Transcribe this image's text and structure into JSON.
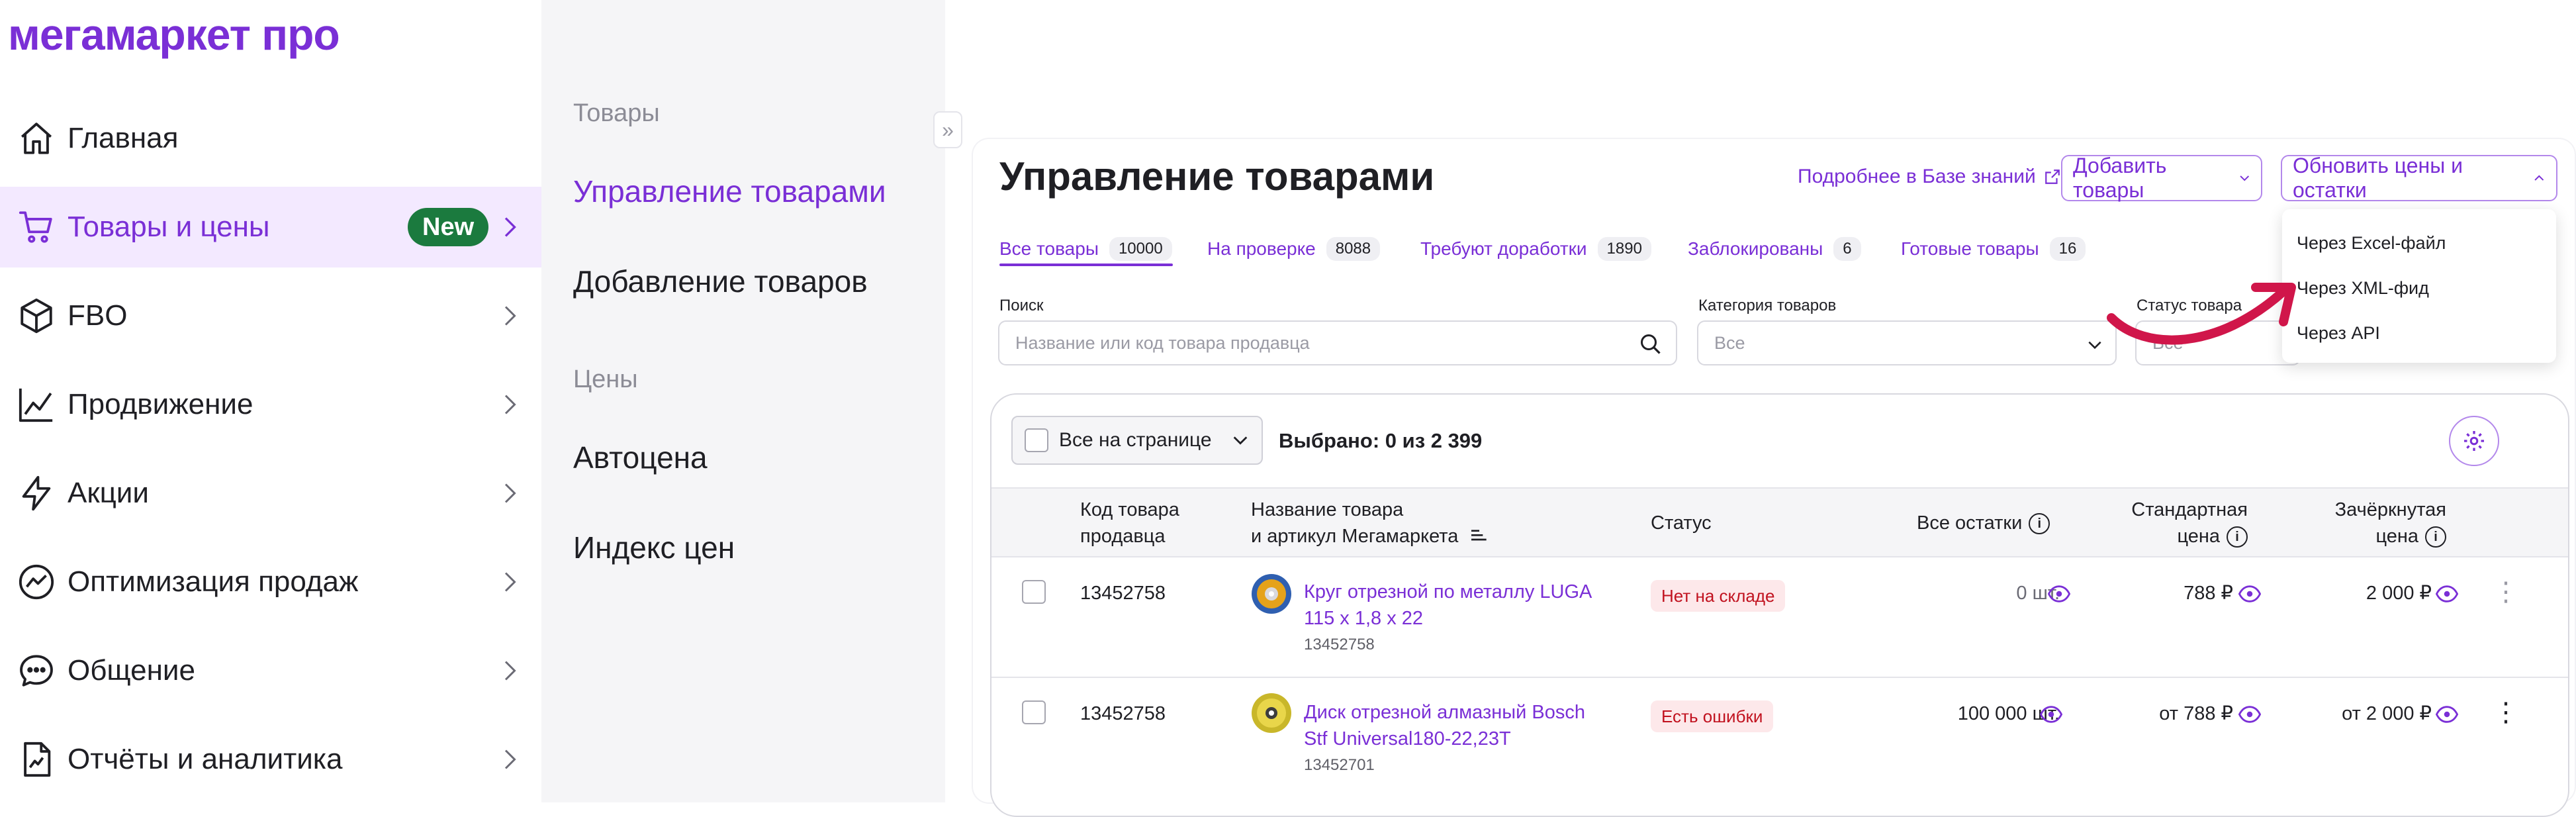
{
  "sidebar": {
    "logo": "мегамаркет про",
    "items": [
      {
        "label": "Главная",
        "icon": "home-icon"
      },
      {
        "label": "Товары и цены",
        "icon": "cart-icon",
        "badge": "New",
        "active": true
      },
      {
        "label": "FBO",
        "icon": "box-icon"
      },
      {
        "label": "Продвижение",
        "icon": "chart-line-icon"
      },
      {
        "label": "Акции",
        "icon": "lightning-icon"
      },
      {
        "label": "Оптимизация продаж",
        "icon": "trend-icon"
      },
      {
        "label": "Общение",
        "icon": "chat-icon"
      },
      {
        "label": "Отчёты и аналитика",
        "icon": "report-icon"
      }
    ]
  },
  "submenu": {
    "section_goods": "Товары",
    "item_manage": "Управление товарами",
    "item_add": "Добавление товаров",
    "section_prices": "Цены",
    "item_autoprice": "Автоцена",
    "item_price_index": "Индекс цен"
  },
  "header": {
    "title": "Управление товарами",
    "kb_link": "Подробнее в Базе знаний",
    "add_goods": "Добавить товары",
    "update_prices": "Обновить цены и остатки"
  },
  "tabs": [
    {
      "label": "Все товары",
      "count": "10000",
      "active": true
    },
    {
      "label": "На проверке",
      "count": "8088"
    },
    {
      "label": "Требуют доработки",
      "count": "1890"
    },
    {
      "label": "Заблокированы",
      "count": "6"
    },
    {
      "label": "Готовые товары",
      "count": "16"
    }
  ],
  "filters": {
    "search_label": "Поиск",
    "search_placeholder": "Название или код товара продавца",
    "category_label": "Категория товаров",
    "category_value": "Все",
    "status_label": "Статус товара",
    "status_value": "Все"
  },
  "dropdown": {
    "items": [
      "Через Excel-файл",
      "Через XML-фид",
      "Через API"
    ]
  },
  "table": {
    "select_all": "Все на странице",
    "selected": "Выбрано: 0 из 2 399",
    "headers": {
      "code_1": "Код товара",
      "code_2": "продавца",
      "name_1": "Название товара",
      "name_2": "и артикул Мегамаркета",
      "status": "Статус",
      "stock": "Все остатки",
      "std_1": "Стандартная",
      "std_2": "цена",
      "crossed_1": "Зачёркнутая",
      "crossed_2": "цена"
    },
    "rows": [
      {
        "code": "13452758",
        "name_1": "Круг отрезной по металлу LUGA",
        "name_2": "115 x 1,8 x 22",
        "sku": "13452758",
        "status": "Нет на складе",
        "stock": "0 шт.",
        "price": "788 ₽",
        "crossed": "2 000 ₽"
      },
      {
        "code": "13452758",
        "name_1": "Диск отрезной алмазный Bosch",
        "name_2": "Stf Universal180-22,23T",
        "sku": "13452701",
        "status": "Есть ошибки",
        "stock": "100 000 шт.",
        "price": "от 788 ₽",
        "crossed": "от 2 000 ₽"
      }
    ]
  },
  "colors": {
    "accent": "#7a2fd6",
    "badge_green": "#1b7a3e",
    "arrow": "#d0164a",
    "status_red": "#c1121f"
  }
}
